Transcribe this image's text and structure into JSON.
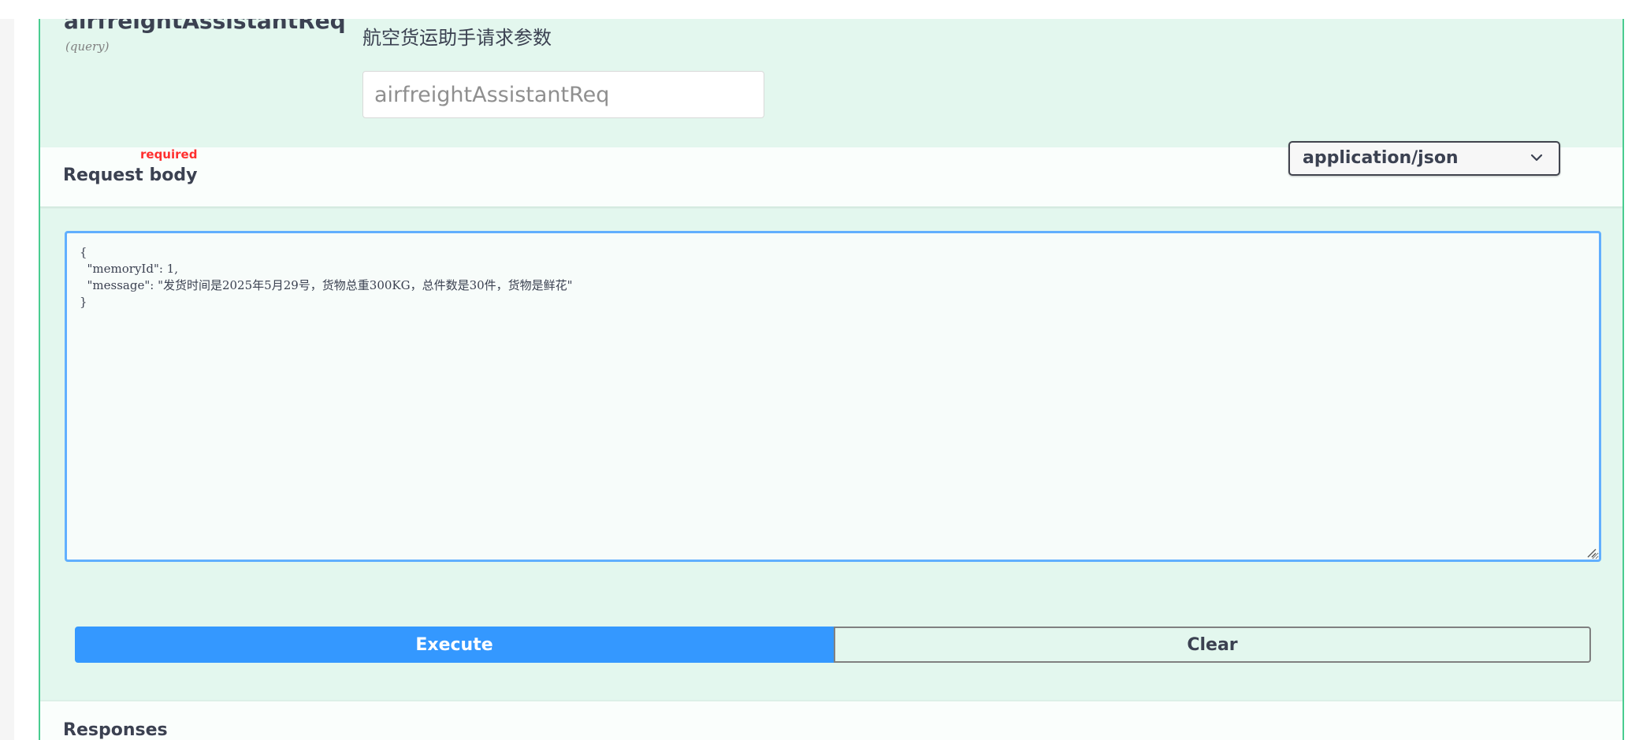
{
  "parameter": {
    "name": "airfreightAssistantReq",
    "in": "(query)",
    "description": "航空货运助手请求参数",
    "placeholder": "airfreightAssistantReq"
  },
  "request_body": {
    "title": "Request body",
    "required_label": "required",
    "content_type": "application/json",
    "value": "{\n  \"memoryId\": 1,\n  \"message\": \"发货时间是2025年5月29号，货物总重300KG，总件数是30件，货物是鲜花\"\n}"
  },
  "buttons": {
    "execute_label": "Execute",
    "clear_label": "Clear"
  },
  "responses": {
    "title": "Responses"
  },
  "colors": {
    "accent_green": "#49cc90",
    "execute_blue": "#3498ff",
    "editor_border": "#61affe",
    "required_red": "#ff2f2f"
  }
}
